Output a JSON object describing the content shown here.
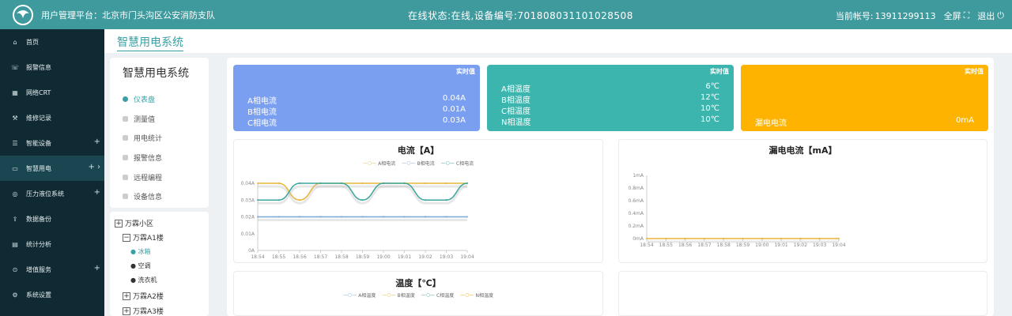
{
  "top": {
    "title": "用户管理平台：北京市门头沟区公安消防支队",
    "status": "在线状态:在线,设备编号:701808031101028508",
    "account_label": "当前帐号:",
    "account": "13911299113",
    "fullscreen": "全屏",
    "logout": "退出"
  },
  "sidebar": {
    "items": [
      {
        "label": "首页",
        "icon": "home-icon"
      },
      {
        "label": "报警信息",
        "icon": "alarm-icon"
      },
      {
        "label": "网络CRT",
        "icon": "grid-icon"
      },
      {
        "label": "维修记录",
        "icon": "wrench-icon"
      },
      {
        "label": "智能设备",
        "icon": "device-icon",
        "plus": "+"
      },
      {
        "label": "智慧用电",
        "icon": "power-icon",
        "plus": "+",
        "active": true
      },
      {
        "label": "压力液位系统",
        "icon": "gauge-icon",
        "plus": "+"
      },
      {
        "label": "数据备份",
        "icon": "upload-icon"
      },
      {
        "label": "统计分析",
        "icon": "chart-icon"
      },
      {
        "label": "增值服务",
        "icon": "coin-icon",
        "plus": "+"
      },
      {
        "label": "系统设置",
        "icon": "gear-icon"
      }
    ]
  },
  "page": {
    "title": "智慧用电系统"
  },
  "left_menu": {
    "title": "智慧用电系统",
    "items": [
      "仪表盘",
      "测量值",
      "用电统计",
      "报警信息",
      "远程编程",
      "设备信息"
    ]
  },
  "tree": {
    "root": "万霖小区",
    "a1": "万霖A1楼",
    "leaves": [
      "冰箱",
      "空调",
      "洗衣机"
    ],
    "a2": "万霖A2楼",
    "a3": "万霖A3楼"
  },
  "cards": {
    "current": {
      "tag": "实时值",
      "rows": [
        {
          "label": "A相电流",
          "value": "0.04A"
        },
        {
          "label": "B相电流",
          "value": "0.01A"
        },
        {
          "label": "C相电流",
          "value": "0.03A"
        }
      ],
      "color": "#7b9ff0"
    },
    "temp": {
      "tag": "实时值",
      "rows": [
        {
          "label": "A相温度",
          "value": "6℃"
        },
        {
          "label": "B相温度",
          "value": "12℃"
        },
        {
          "label": "C相温度",
          "value": "10℃"
        },
        {
          "label": "N相温度",
          "value": "10℃"
        }
      ],
      "color": "#3bb5ad"
    },
    "leak": {
      "tag": "实时值",
      "rows": [
        {
          "label": "漏电电流",
          "value": "0mA"
        }
      ],
      "color": "#fdb300"
    }
  },
  "chart_data": [
    {
      "type": "line",
      "title": "电流【A】",
      "x": [
        "18:54",
        "18:55",
        "18:56",
        "18:57",
        "18:58",
        "18:59",
        "19:00",
        "19:01",
        "19:02",
        "19:03",
        "19:04"
      ],
      "yticks": [
        "0A",
        "0.01A",
        "0.02A",
        "0.03A",
        "0.04A"
      ],
      "ylim": [
        0,
        0.04
      ],
      "series": [
        {
          "name": "A相电流",
          "color": "#e9b33b",
          "values": [
            0.04,
            0.04,
            0.03,
            0.04,
            0.04,
            0.04,
            0.04,
            0.04,
            0.04,
            0.04,
            0.04
          ]
        },
        {
          "name": "B相电流",
          "color": "#7aa6d6",
          "values": [
            0.02,
            0.02,
            0.02,
            0.02,
            0.02,
            0.02,
            0.02,
            0.02,
            0.02,
            0.02,
            0.02
          ]
        },
        {
          "name": "C相电流",
          "color": "#3aa69e",
          "values": [
            0.03,
            0.03,
            0.04,
            0.04,
            0.04,
            0.03,
            0.04,
            0.04,
            0.03,
            0.03,
            0.04
          ]
        }
      ]
    },
    {
      "type": "line",
      "title": "漏电电流【mA】",
      "x": [
        "18:54",
        "18:55",
        "18:56",
        "18:57",
        "18:58",
        "18:59",
        "19:00",
        "19:01",
        "19:02",
        "19:03",
        "19:04"
      ],
      "yticks": [
        "0mA",
        "0.2mA",
        "0.4mA",
        "0.6mA",
        "0.8mA",
        "1mA"
      ],
      "ylim": [
        0,
        1
      ],
      "series": [
        {
          "name": "漏电电流",
          "color": "#e9b33b",
          "values": [
            0,
            0,
            0,
            0,
            0,
            0,
            0,
            0,
            0,
            0,
            0
          ]
        }
      ]
    },
    {
      "type": "line",
      "title": "温度【℃】",
      "legend": [
        "A相温度",
        "B相温度",
        "C相温度",
        "N相温度"
      ],
      "colors": [
        "#7aa6d6",
        "#e9b33b",
        "#3aa69e",
        "#f0a800"
      ]
    }
  ]
}
